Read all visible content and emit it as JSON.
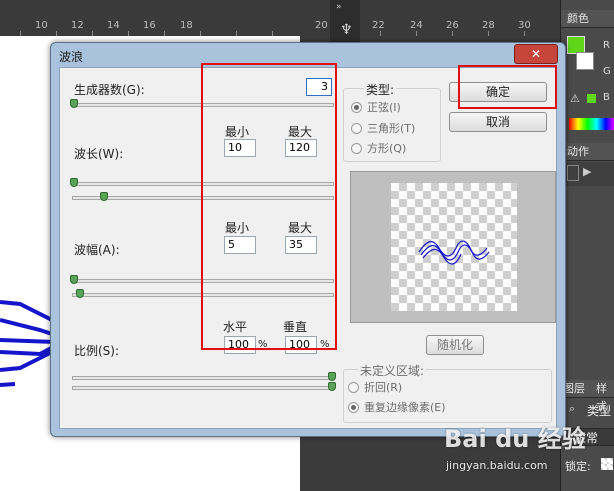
{
  "ps": {
    "ruler_numbers": [
      "10",
      "12",
      "14",
      "16",
      "18",
      "20",
      "22",
      "24",
      "26",
      "28",
      "30"
    ],
    "right_panel": {
      "color_tab": "颜色",
      "label_r": "R",
      "label_g": "G",
      "label_b": "B",
      "actions_tab": "动作",
      "layers_tab": "图层",
      "styles_tab": "样式",
      "kind_label": "类型",
      "blend_mode": "正常",
      "lock_label": "锁定:"
    }
  },
  "dialog": {
    "title": "波浪",
    "close": "✕",
    "generators": {
      "label": "生成器数(G):",
      "value": "3",
      "level": 0.0
    },
    "wavelength": {
      "label": "波长(W):",
      "min_label": "最小",
      "max_label": "最大",
      "min": "10",
      "max": "120"
    },
    "amplitude": {
      "label": "波幅(A):",
      "min_label": "最小",
      "max_label": "最大",
      "min": "5",
      "max": "35"
    },
    "scale": {
      "label": "比例(S):",
      "h_label": "水平",
      "v_label": "垂直",
      "h": "100",
      "v": "100",
      "unit": "%"
    },
    "type": {
      "label": "类型:",
      "options": [
        "正弦(I)",
        "三角形(T)",
        "方形(Q)"
      ],
      "selected": 0
    },
    "ok_button": "确定",
    "cancel_button": "取消",
    "randomize_button": "随机化",
    "undefined_area": {
      "label": "未定义区域:",
      "options": [
        "折回(R)",
        "重复边缘像素(E)"
      ],
      "selected": 1
    }
  },
  "watermark": {
    "brand": "Bai du 经验",
    "url": "jingyan.baidu.com"
  },
  "colors": {
    "accent_red": "#e01010",
    "foreground_swatch": "#5fd61a",
    "wave_blue": "#1515cc"
  }
}
